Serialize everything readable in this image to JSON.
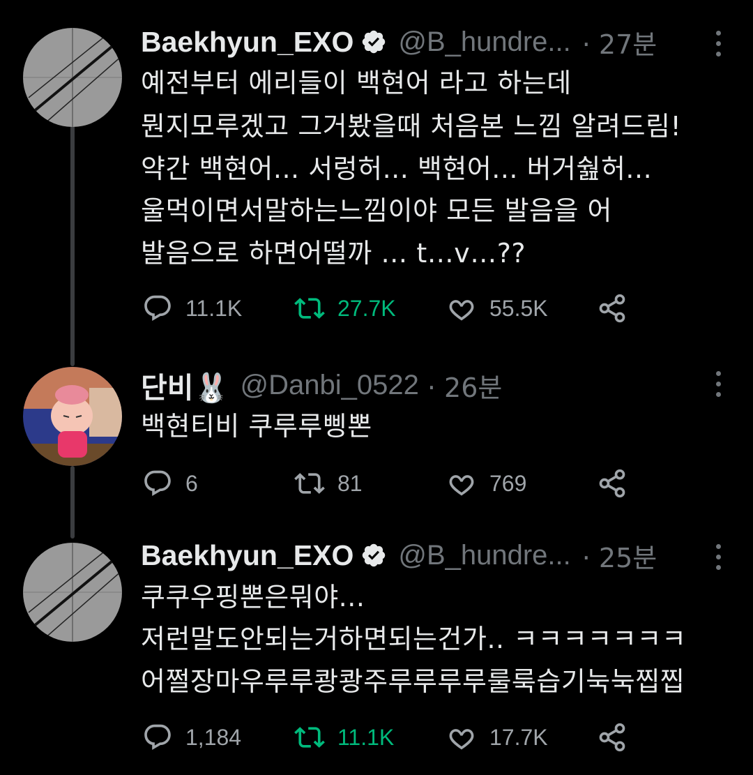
{
  "tweets": [
    {
      "name": "Baekhyun_EXO",
      "handle": "@B_hundre...",
      "time": "· 27분",
      "lines": [
        "예전부터 에리들이 백현어 라고 하는데",
        "뭔지모루겠고 그거봤을때 처음본 느낌 알려드림!",
        "약간 백현어... 서렁허... 백현어... 버거쉂허...",
        "울먹이면서말하는느낌이야 모든 발음을 어",
        "발음으로 하면어떨까 … t…v…??"
      ],
      "replies": "11.1K",
      "retweets": "27.7K",
      "likes": "55.5K",
      "retweeted": true
    },
    {
      "name": "단비🐰",
      "handle": "@Danbi_0522",
      "time": "· 26분",
      "lines": [
        "백현티비 쿠루루삥뽄"
      ],
      "replies": "6",
      "retweets": "81",
      "likes": "769",
      "retweeted": false
    },
    {
      "name": "Baekhyun_EXO",
      "handle": "@B_hundre...",
      "time": "· 25분",
      "lines": [
        "쿠쿠우핑뽄은뭐야...",
        "저런말도안되는거하면되는건가.. ㅋㅋㅋㅋㅋㅋㅋ",
        "어쩔장마우루루쾅쾅주루루루루룰룩습기눅눅찝찝"
      ],
      "replies": "1,184",
      "retweets": "11.1K",
      "likes": "17.7K",
      "retweeted": true
    }
  ],
  "colors": {
    "background": "#000000",
    "text": "#e7e9ea",
    "secondary": "#71767b",
    "retweet_active": "#00ba7c",
    "thread_line": "#3a3c3f"
  },
  "icons": {
    "reply": "reply-icon",
    "retweet": "retweet-icon",
    "like": "like-icon",
    "share": "share-icon",
    "more": "more-icon",
    "verified": "verified-badge-icon"
  }
}
